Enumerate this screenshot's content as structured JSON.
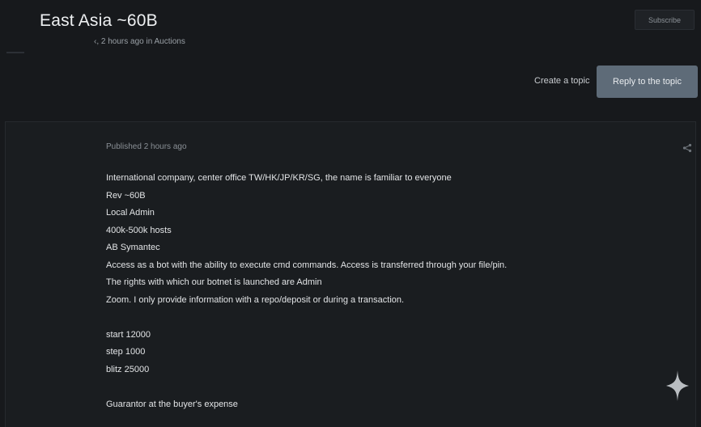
{
  "topic": {
    "title": "East Asia ~60B",
    "meta": "‹, 2 hours ago in Auctions"
  },
  "buttons": {
    "subscribe": "Subscribe",
    "create_topic": "Create a topic",
    "reply": "Reply to the topic"
  },
  "post": {
    "published": "Published 2 hours ago",
    "lines": [
      "International company, center office TW/HK/JP/KR/SG, the name is familiar to everyone",
      "Rev ~60B",
      "Local Admin",
      "400k-500k hosts",
      "AB Symantec",
      "Access as a bot with the ability to execute cmd commands. Access is transferred through your file/pin.",
      "The rights with which our botnet is launched are Admin",
      "Zoom. I only provide information with a repo/deposit or during a transaction.",
      "",
      "start 12000",
      "step 1000",
      "blitz 25000",
      "",
      "Guarantor at the buyer's expense"
    ]
  },
  "icons": {
    "share": "share-icon",
    "sparkle": "sparkle-icon"
  }
}
